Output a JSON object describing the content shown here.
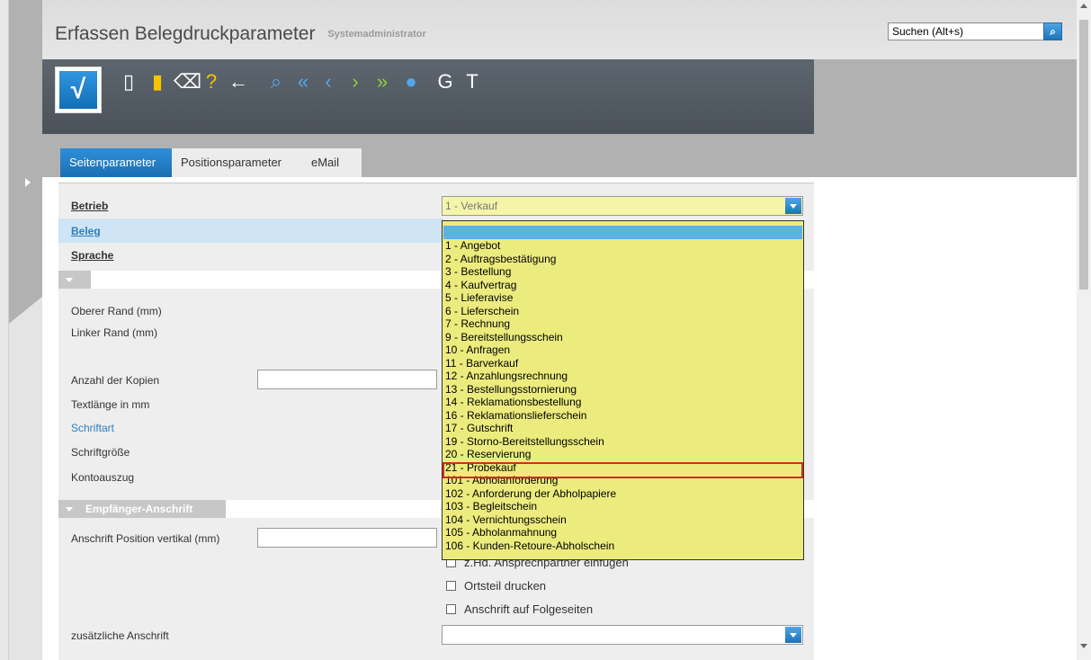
{
  "window": {
    "title": "Erfassen Belegdruckparameter",
    "user": "Systemadministrator"
  },
  "search": {
    "placeholder": "Suchen (Alt+s)",
    "button_icon": "search-icon"
  },
  "toolbar": {
    "save_icon": "checkmark-icon",
    "icons": [
      {
        "name": "new-document-icon",
        "glyph": "▯"
      },
      {
        "name": "open-folder-icon",
        "glyph": "▮"
      },
      {
        "name": "delete-trash-icon",
        "glyph": "⌫"
      },
      {
        "name": "help-icon",
        "glyph": "?"
      },
      {
        "name": "back-arrow-icon",
        "glyph": "←"
      },
      {
        "name": "search-zoom-icon",
        "glyph": "⌕"
      },
      {
        "name": "first-record-icon",
        "glyph": "«"
      },
      {
        "name": "previous-record-icon",
        "glyph": "‹"
      },
      {
        "name": "next-record-icon",
        "glyph": "›"
      },
      {
        "name": "last-record-icon",
        "glyph": "»"
      },
      {
        "name": "info-bubble-icon",
        "glyph": "●"
      },
      {
        "name": "g-letter",
        "glyph": "G"
      },
      {
        "name": "t-letter",
        "glyph": "T"
      }
    ]
  },
  "tabs": [
    {
      "label": "Seitenparameter",
      "active": true
    },
    {
      "label": "Positionsparameter",
      "active": false
    },
    {
      "label": "eMail",
      "active": false
    }
  ],
  "form": {
    "betrieb_label": "Betrieb",
    "betrieb_value": "1 - Verkauf",
    "beleg_label": "Beleg",
    "sprache_label": "Sprache",
    "oberer_rand_label": "Oberer Rand (mm)",
    "linker_rand_label": "Linker Rand (mm)",
    "anzahl_kopien_label": "Anzahl der Kopien",
    "textlaenge_label": "Textlänge in mm",
    "schriftart_label": "Schriftart",
    "schriftgroesse_label": "Schriftgröße",
    "kontoauszug_label": "Kontoauszug",
    "section_empfaenger": "Empfänger-Anschrift",
    "anschrift_position_label": "Anschrift Position vertikal (mm)",
    "checkbox_zhd": "z.Hd. Ansprechpartner einfügen",
    "checkbox_ortsteil": "Ortsteil drucken",
    "checkbox_folgeseiten": "Anschrift auf Folgeseiten",
    "zusaetzliche_anschrift_label": "zusätzliche Anschrift"
  },
  "dropdown": {
    "selected_index": 18,
    "items": [
      "1 - Angebot",
      "2 - Auftragsbestätigung",
      "3 - Bestellung",
      "4 - Kaufvertrag",
      "5 - Lieferavise",
      "6 - Lieferschein",
      "7 - Rechnung",
      "9 - Bereitstellungsschein",
      "10 - Anfragen",
      "11 - Barverkauf",
      "12 - Anzahlungsrechnung",
      "13 - Bestellungsstornierung",
      "14 - Reklamationsbestellung",
      "16 - Reklamationslieferschein",
      "17 - Gutschrift",
      "19 - Storno-Bereitstellungsschein",
      "20 - Reservierung",
      "21 - Probekauf",
      "101 - Abholanforderung",
      "102 - Anforderung der Abholpapiere",
      "103 - Begleitschein",
      "104 - Vernichtungsschein",
      "105 - Abholanmahnung",
      "106 - Kunden-Retoure-Abholschein"
    ]
  },
  "colors": {
    "accent_blue": "#1b6fb3",
    "dropdown_yellow": "#ecec7e",
    "highlight_red": "#d42a20",
    "toolbar_dark": "#555c64"
  }
}
